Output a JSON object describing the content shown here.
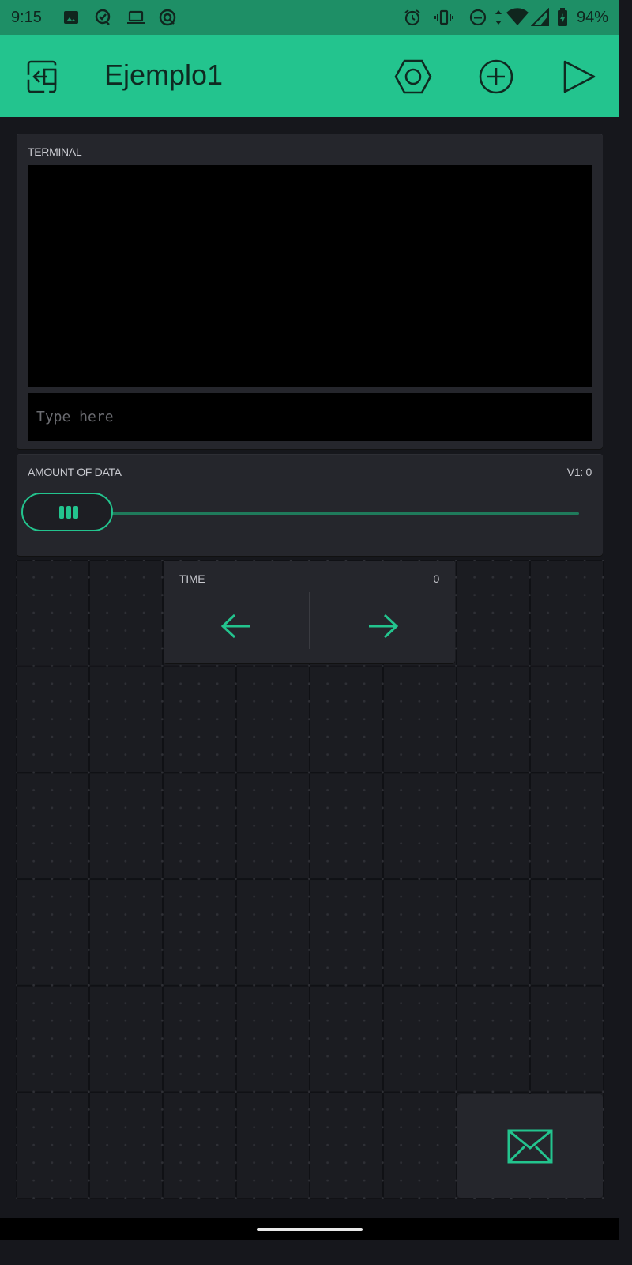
{
  "status_bar": {
    "time": "9:15",
    "battery_percent": "94%"
  },
  "app_bar": {
    "title": "Ejemplo1"
  },
  "terminal": {
    "label": "TERMINAL",
    "input_placeholder": "Type here",
    "input_value": ""
  },
  "slider": {
    "label": "AMOUNT OF DATA",
    "pin_value": "V1: 0",
    "value": 0
  },
  "time_step": {
    "label": "TIME",
    "value": "0"
  },
  "colors": {
    "accent": "#23c48e",
    "app_bar": "#23c48e",
    "status_bar": "#1e8f66",
    "background": "#16171c",
    "widget": "#25262c"
  },
  "icons": [
    "image-icon",
    "quickly-icon",
    "laptop-icon",
    "no-disturb-app-icon",
    "alarm-icon",
    "vibrate-icon",
    "dnd-icon",
    "data-arrows-icon",
    "wifi-icon",
    "signal-icon",
    "battery-icon",
    "exit-icon",
    "settings-hex-icon",
    "add-icon",
    "play-icon",
    "left-arrow-icon",
    "right-arrow-icon",
    "email-icon"
  ]
}
